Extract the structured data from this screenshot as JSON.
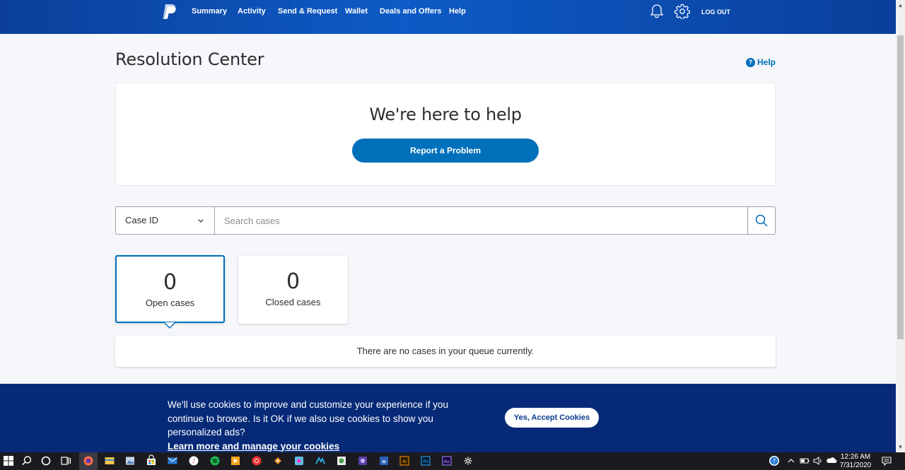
{
  "nav": {
    "items": [
      "Summary",
      "Activity",
      "Send & Request",
      "Wallet",
      "Deals and Offers",
      "Help"
    ],
    "logout": "LOG OUT"
  },
  "page": {
    "title": "Resolution Center",
    "help_link": "Help"
  },
  "hero": {
    "title": "We're here to help",
    "report_button": "Report a Problem"
  },
  "search": {
    "type_selected": "Case ID",
    "placeholder": "Search cases"
  },
  "cases": {
    "open_count": "0",
    "open_label": "Open cases",
    "closed_count": "0",
    "closed_label": "Closed cases",
    "empty_message": "There are no cases in your queue currently."
  },
  "cookie": {
    "text": "We'll use cookies to improve and customize your experience if you continue to browse. Is it OK if we also use cookies to show you personalized ads?",
    "link": "Learn more and manage your cookies",
    "accept_button": "Yes, Accept Cookies"
  },
  "colors": {
    "brand_blue": "#0070ba",
    "nav_blue": "#0d5bc6",
    "cookie_bar": "#062a78"
  },
  "taskbar": {
    "icons": [
      "windows-start-icon",
      "search-icon",
      "cortana-icon",
      "task-view-icon",
      "firefox-icon",
      "file-explorer-icon",
      "photos-icon",
      "store-icon",
      "mail-icon",
      "itunes-icon",
      "spotify-icon",
      "media-player-icon",
      "chrome-icon",
      "app-icon",
      "app-icon",
      "app-icon",
      "app-icon",
      "app-icon",
      "word-icon",
      "illustrator-icon",
      "photoshop-icon",
      "after-effects-icon",
      "settings-icon"
    ],
    "time": "12:26 AM",
    "date": "7/31/2020"
  }
}
